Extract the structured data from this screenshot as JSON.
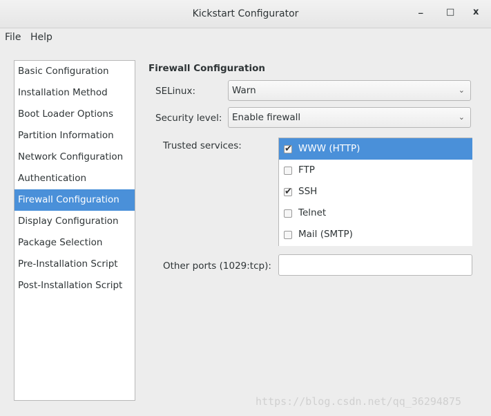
{
  "window": {
    "title": "Kickstart Configurator",
    "minimize": "_",
    "maximize": "□",
    "close": "x"
  },
  "menu": [
    "File",
    "Help"
  ],
  "sidebar": {
    "items": [
      "Basic Configuration",
      "Installation Method",
      "Boot Loader Options",
      "Partition Information",
      "Network Configuration",
      "Authentication",
      "Firewall Configuration",
      "Display Configuration",
      "Package Selection",
      "Pre-Installation Script",
      "Post-Installation Script"
    ],
    "selected": 6
  },
  "main": {
    "heading": "Firewall Configuration",
    "selinux_label": "SELinux:",
    "selinux_value": "Warn",
    "security_label": "Security level:",
    "security_value": "Enable firewall",
    "trusted_label": "Trusted services:",
    "services": [
      {
        "label": "WWW (HTTP)",
        "checked": true,
        "selected": true
      },
      {
        "label": "FTP",
        "checked": false
      },
      {
        "label": "SSH",
        "checked": true
      },
      {
        "label": "Telnet",
        "checked": false
      },
      {
        "label": "Mail (SMTP)",
        "checked": false
      }
    ],
    "other_ports_label": "Other ports (1029:tcp):",
    "other_ports_value": ""
  },
  "watermark": "https://blog.csdn.net/qq_36294875",
  "colors": {
    "selection": "#4a90d9"
  }
}
